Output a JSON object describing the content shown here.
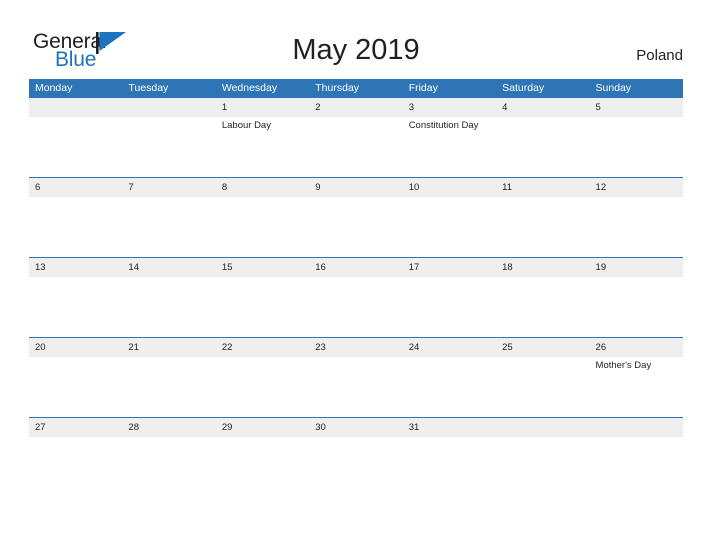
{
  "brand": {
    "name_part1": "General",
    "name_part2": "Blue",
    "flag_icon": "blue-flag-triangle",
    "color_dark": "#231f20",
    "color_blue": "#1e73be"
  },
  "header": {
    "title": "May 2019",
    "country": "Poland"
  },
  "theme": {
    "header_blue": "#2e75b6",
    "row_gray": "#efefef",
    "text": "#231f20",
    "white": "#ffffff"
  },
  "calendar": {
    "month": "May",
    "year": "2019",
    "weekday_headers": [
      "Monday",
      "Tuesday",
      "Wednesday",
      "Thursday",
      "Friday",
      "Saturday",
      "Sunday"
    ],
    "weeks": [
      {
        "days": [
          {
            "date": "",
            "event": ""
          },
          {
            "date": "",
            "event": ""
          },
          {
            "date": "1",
            "event": "Labour Day"
          },
          {
            "date": "2",
            "event": ""
          },
          {
            "date": "3",
            "event": "Constitution Day"
          },
          {
            "date": "4",
            "event": ""
          },
          {
            "date": "5",
            "event": ""
          }
        ]
      },
      {
        "days": [
          {
            "date": "6",
            "event": ""
          },
          {
            "date": "7",
            "event": ""
          },
          {
            "date": "8",
            "event": ""
          },
          {
            "date": "9",
            "event": ""
          },
          {
            "date": "10",
            "event": ""
          },
          {
            "date": "11",
            "event": ""
          },
          {
            "date": "12",
            "event": ""
          }
        ]
      },
      {
        "days": [
          {
            "date": "13",
            "event": ""
          },
          {
            "date": "14",
            "event": ""
          },
          {
            "date": "15",
            "event": ""
          },
          {
            "date": "16",
            "event": ""
          },
          {
            "date": "17",
            "event": ""
          },
          {
            "date": "18",
            "event": ""
          },
          {
            "date": "19",
            "event": ""
          }
        ]
      },
      {
        "days": [
          {
            "date": "20",
            "event": ""
          },
          {
            "date": "21",
            "event": ""
          },
          {
            "date": "22",
            "event": ""
          },
          {
            "date": "23",
            "event": ""
          },
          {
            "date": "24",
            "event": ""
          },
          {
            "date": "25",
            "event": ""
          },
          {
            "date": "26",
            "event": "Mother's Day"
          }
        ]
      },
      {
        "days": [
          {
            "date": "27",
            "event": ""
          },
          {
            "date": "28",
            "event": ""
          },
          {
            "date": "29",
            "event": ""
          },
          {
            "date": "30",
            "event": ""
          },
          {
            "date": "31",
            "event": ""
          },
          {
            "date": "",
            "event": ""
          },
          {
            "date": "",
            "event": ""
          }
        ]
      }
    ]
  }
}
